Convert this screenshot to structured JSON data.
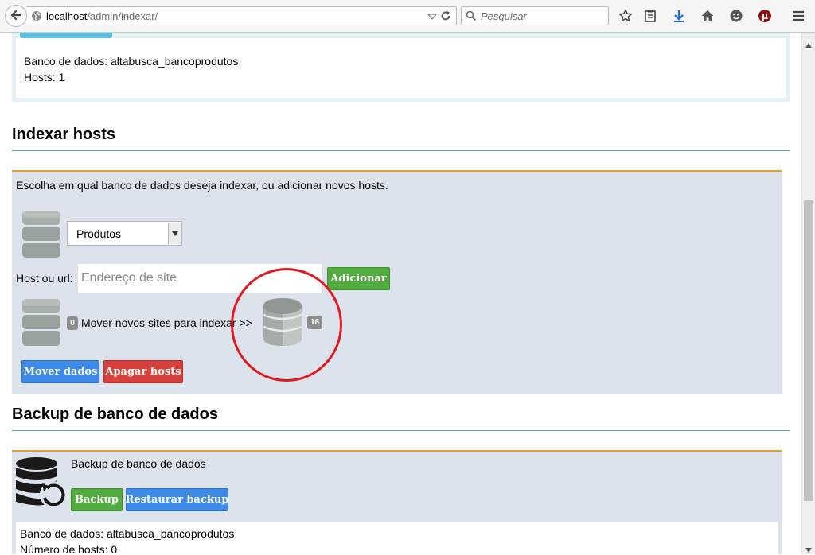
{
  "browser": {
    "url_host": "localhost",
    "url_path": "/admin/indexar/",
    "search_placeholder": "Pesquisar",
    "addon_label": "µ"
  },
  "top_panel": {
    "database_line": "Banco de dados: altabusca_bancoprodutos",
    "hosts_line": "Hosts: 1"
  },
  "index_section": {
    "title": "Indexar hosts",
    "instructions": "Escolha em qual banco de dados deseja indexar, ou adicionar novos hosts.",
    "select_value": "Produtos",
    "host_label": "Host ou url:",
    "site_placeholder": "Endereço de site",
    "add_button": "Adicionar",
    "source_count": "0",
    "move_text": "Mover novos sites para indexar >>",
    "target_count": "16",
    "move_button": "Mover dados",
    "delete_button": "Apagar hosts"
  },
  "backup_section": {
    "title": "Backup de banco de dados",
    "heading": "Backup de banco de dados",
    "backup_button": "Backup",
    "restore_button": "Restaurar backup",
    "database_line": "Banco de dados: altabusca_bancoprodutos",
    "hosts_line": "Número de hosts: 0"
  },
  "colors": {
    "panel_bg": "#dde3ec",
    "panel_accent": "#d9a82a",
    "green": "#52ab3e",
    "blue": "#3d8ae8",
    "red": "#d5423b",
    "annotation": "#e0191e"
  },
  "icons": [
    "back-arrow-icon",
    "globe-icon",
    "reload-icon",
    "search-icon",
    "star-icon",
    "reading-list-icon",
    "download-icon",
    "home-icon",
    "chat-icon",
    "utorrent-icon",
    "menu-icon",
    "database-icon",
    "database-restore-icon"
  ]
}
